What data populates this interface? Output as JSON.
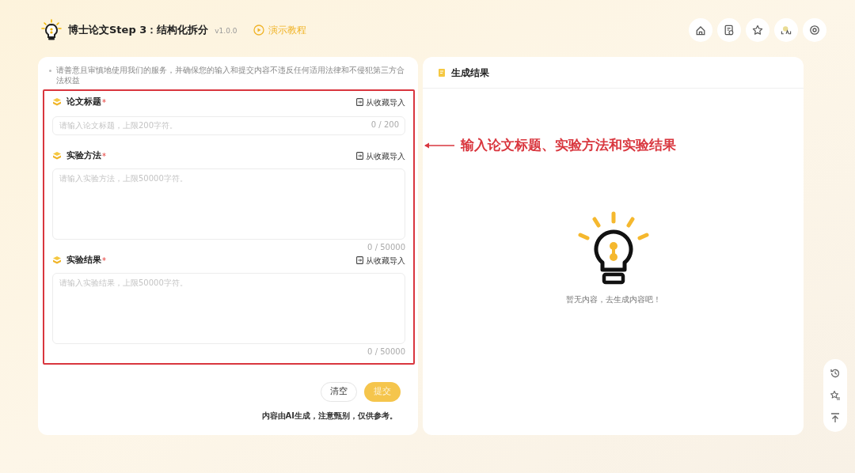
{
  "header": {
    "title": "博士论文Step 3：结构化拆分",
    "version": "v1.0.0",
    "tutorial_link": "演示教程"
  },
  "form": {
    "notice": "请善意且审慎地使用我们的服务，并确保您的输入和提交内容不违反任何适用法律和不侵犯第三方合法权益",
    "fields": [
      {
        "kind": "input",
        "label": "论文标题",
        "required_mark": "*",
        "import_link": "从收藏导入",
        "placeholder": "请输入论文标题，上限200字符。",
        "counter": "0 / 200"
      },
      {
        "kind": "textarea",
        "label": "实验方法",
        "required_mark": "*",
        "import_link": "从收藏导入",
        "placeholder": "请输入实验方法，上限50000字符。",
        "counter": "0 / 50000"
      },
      {
        "kind": "textarea",
        "label": "实验结果",
        "required_mark": "*",
        "import_link": "从收藏导入",
        "placeholder": "请输入实验结果，上限50000字符。",
        "counter": "0 / 50000"
      }
    ],
    "buttons": [
      {
        "kind": "clear",
        "label": "清空",
        "disabled": false
      },
      {
        "kind": "submit",
        "label": "提交",
        "disabled": true
      }
    ],
    "footnote": "内容由AI生成，注意甄别，仅供参考。"
  },
  "annotation": {
    "text": "输入论文标题、实验方法和实验结果"
  },
  "result": {
    "title": "生成结果",
    "empty_message": "暂无内容，去生成内容吧！"
  }
}
